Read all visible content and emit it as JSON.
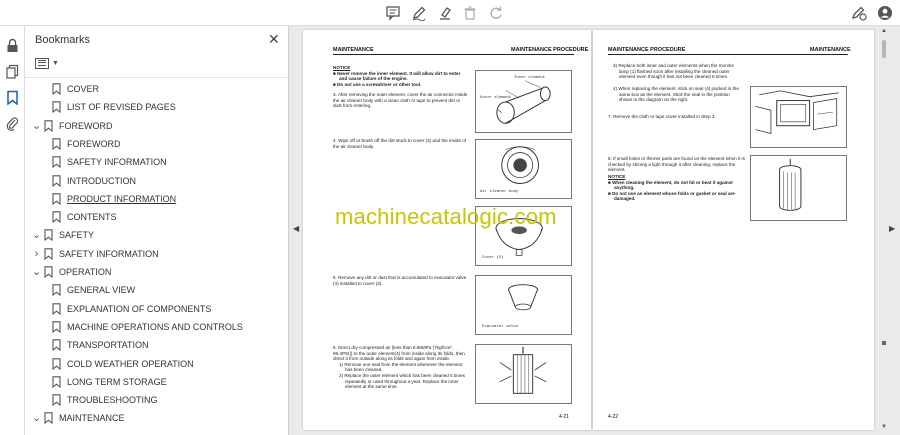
{
  "toolbar": {
    "icons": [
      "comment-icon",
      "pen-icon",
      "highlight-icon",
      "delete-icon",
      "redo-icon",
      "fill-sign-icon",
      "account-icon"
    ]
  },
  "rail": {
    "icons": [
      "lock-icon",
      "pages-icon",
      "bookmark-icon",
      "attachment-icon"
    ]
  },
  "bookmarks": {
    "title": "Bookmarks",
    "close": "✕",
    "items": [
      {
        "label": "COVER",
        "expander": ""
      },
      {
        "label": "LIST OF REVISED PAGES",
        "expander": ""
      },
      {
        "label": "FOREWORD",
        "expander": "open"
      },
      {
        "label": "FOREWORD",
        "expander": ""
      },
      {
        "label": "SAFETY INFORMATION",
        "expander": ""
      },
      {
        "label": "INTRODUCTION",
        "expander": ""
      },
      {
        "label": "PRODUCT INFORMATION",
        "expander": "",
        "selected": true
      },
      {
        "label": "CONTENTS",
        "expander": ""
      },
      {
        "label": "SAFETY",
        "expander": "open"
      },
      {
        "label": "SAFETY INFORMATION",
        "expander": "closed"
      },
      {
        "label": "OPERATION",
        "expander": "open"
      },
      {
        "label": "GENERAL VIEW",
        "expander": ""
      },
      {
        "label": "EXPLANATION OF COMPONENTS",
        "expander": ""
      },
      {
        "label": "MACHINE OPERATIONS AND CONTROLS",
        "expander": ""
      },
      {
        "label": "TRANSPORTATION",
        "expander": ""
      },
      {
        "label": "COLD WEATHER OPERATION",
        "expander": ""
      },
      {
        "label": "LONG TERM STORAGE",
        "expander": ""
      },
      {
        "label": "TROUBLESHOOTING",
        "expander": ""
      },
      {
        "label": "MAINTENANCE",
        "expander": "open"
      }
    ]
  },
  "doc": {
    "left": {
      "header_left": "MAINTENANCE",
      "header_right": "MAINTENANCE PROCEDURE",
      "notice_title": "NOTICE",
      "notice_1": "Never remove the inner element. It will allow dirt to enter and cause failure of the engine.",
      "notice_2": "Do not use a screwdriver or other tool.",
      "step3": "3.  After removing the outer element, cover the air connector inside the air cleaner body with a clean cloth or tape to prevent dirt or dust from entering.",
      "step4": "4.  Wipe off or brush off the dirt stuck to cover (3) and the inside of the air cleaner body.",
      "step5": "5.  Remove any dirt or dust that is accumulated to evacuator valve (4) installed to cover (3).",
      "step6": "6.  Direct dry compressed air (less than 0.69MPa {7kgf/cm², 99.4PSI}) to the outer element(4) from inside along its folds, then direct it from outside along its folds and again from inside.",
      "step6_1": "1)  Remove one seal from the element whenever the element has been cleaned.",
      "step6_2": "2)  Replace the outer element which has been cleaned 5 times repeatedly or used throughout a year. Replace the inner element at the same time.",
      "fig1_label_a": "Inner element",
      "fig1_label_b": "Outer element",
      "fig2_label": "Air cleaner body",
      "fig3_label": "Cover (3)",
      "fig4_label": "Evacuator valve",
      "page_number": "4-21"
    },
    "right": {
      "header_left": "MAINTENANCE PROCEDURE",
      "header_right": "MAINTENANCE",
      "step3_cont": "3)  Replace both inner and outer elements when the monitor lamp (1) flashed soon after installing the cleaned outer element even though it has not been cleaned 5 times.",
      "step4_cont": "4)  When replacing the element, stick on seal (4) packed in the same box as the element.  Stick the seal in the position shown in the diagram on the right.",
      "step7": "7.  Remove the cloth or tape cover installed in Step 3.",
      "step8": "8.  If small holes or thinner parts are found on the element when it is checked by shining a light through it after cleaning, replace the element.",
      "notice_title": "NOTICE",
      "notice_1": "When cleaning the element, do not hit or beat it against anything.",
      "notice_2": "Do not use an element whose folds or gasket or seal are damaged.",
      "page_number": "4-22"
    }
  },
  "watermark": "machinecatalogic.com"
}
